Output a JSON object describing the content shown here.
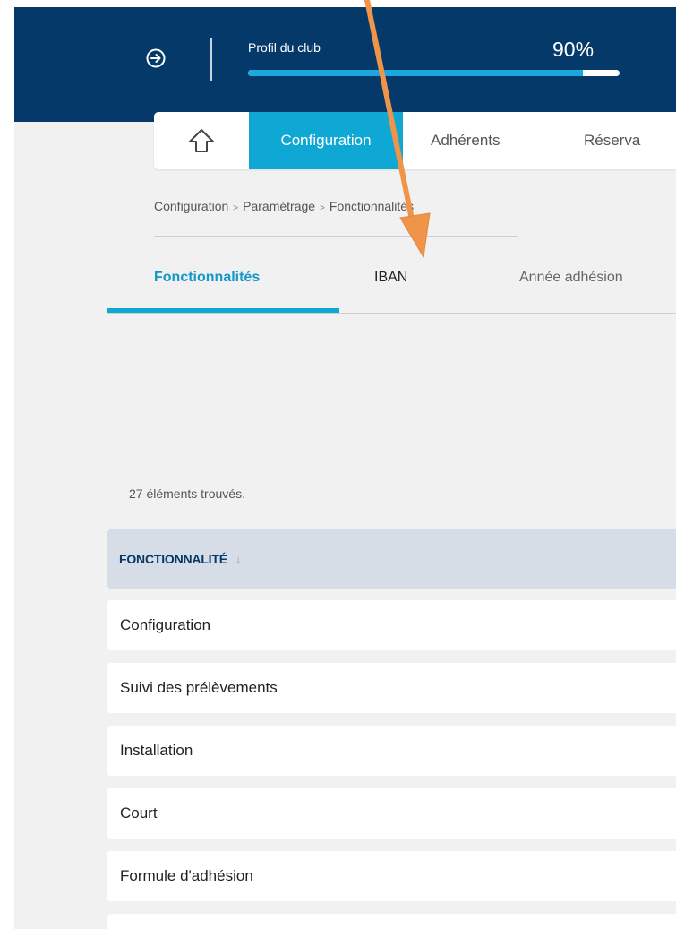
{
  "topbar": {
    "profile_label": "Profil du club",
    "profile_percent": "90%",
    "profile_progress": 0.9,
    "logout_icon": "logout-circle-arrow-icon"
  },
  "navbar": {
    "home_icon": "home-arrow-up-icon",
    "tabs": [
      {
        "label": "Configuration",
        "active": true
      },
      {
        "label": "Adhérents",
        "active": false
      },
      {
        "label": "Réserva",
        "active": false
      }
    ]
  },
  "breadcrumb": {
    "items": [
      "Configuration",
      "Paramétrage",
      "Fonctionnalités"
    ]
  },
  "subtabs": [
    {
      "label": "Fonctionnalités",
      "active": true
    },
    {
      "label": "IBAN",
      "active": false
    },
    {
      "label": "Année adhésion",
      "active": false
    }
  ],
  "results": {
    "count_text": "27 éléments trouvés."
  },
  "table": {
    "header": "FONCTIONNALITÉ",
    "sort_icon": "sort-down-arrow-icon",
    "rows": [
      "Configuration",
      "Suivi des prélèvements",
      "Installation",
      "Court",
      "Formule d'adhésion"
    ]
  },
  "colors": {
    "topbar": "#04396a",
    "accent": "#0fa7d4",
    "annotation_arrow": "#f0944a"
  }
}
